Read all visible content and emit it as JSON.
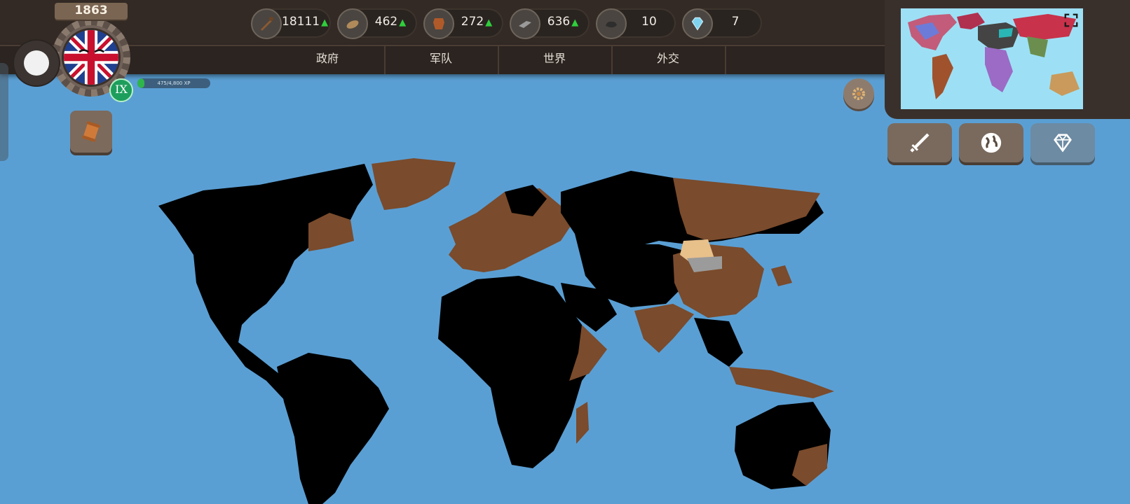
{
  "header": {
    "year": "1863",
    "rank": "IX",
    "xp": {
      "text": "475/4,800 XP",
      "current": 475,
      "max": 4800
    }
  },
  "resources": [
    {
      "name": "wood-icon",
      "value": "18111",
      "trend": "up"
    },
    {
      "name": "bread-icon",
      "value": "462",
      "trend": "up"
    },
    {
      "name": "leather-icon",
      "value": "272",
      "trend": "up"
    },
    {
      "name": "iron-icon",
      "value": "636",
      "trend": "up"
    },
    {
      "name": "coal-icon",
      "value": "10",
      "trend": "none"
    },
    {
      "name": "diamond-icon",
      "value": "7",
      "trend": "none"
    }
  ],
  "tabs": [
    {
      "label": "政府"
    },
    {
      "label": "军队"
    },
    {
      "label": "世界"
    },
    {
      "label": "外交"
    }
  ],
  "colors": {
    "ocean": "#5a9fd4",
    "owned_land": "#000000",
    "other_land": "#7a4b2c",
    "trend_up": "#2fcf3c"
  }
}
